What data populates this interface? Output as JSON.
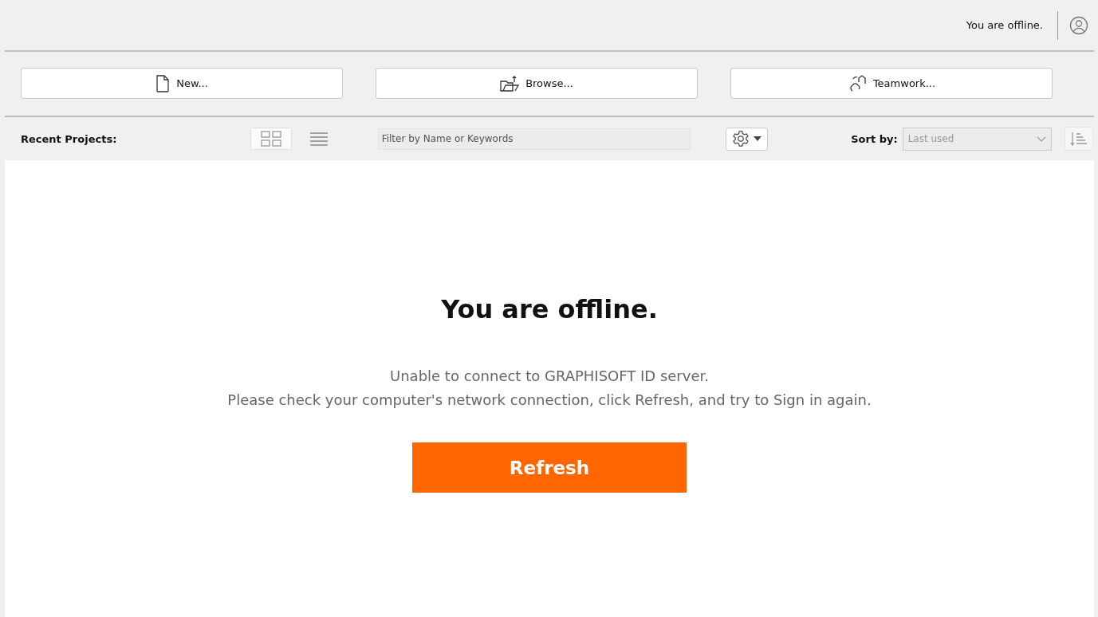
{
  "header": {
    "status": "You are offline."
  },
  "actions": [
    {
      "kind": "new",
      "label": "New..."
    },
    {
      "kind": "browse",
      "label": "Browse..."
    },
    {
      "kind": "teamwork",
      "label": "Teamwork..."
    }
  ],
  "toolbar": {
    "label": "Recent Projects:",
    "views": [
      {
        "kind": "grid",
        "selected": true
      },
      {
        "kind": "list",
        "selected": false
      }
    ],
    "filter": {
      "placeholder": "Filter by Name or Keywords"
    },
    "sort_label": "Sort by:",
    "sort": {
      "value": "Last used",
      "disabled": true
    }
  },
  "message": {
    "title": "You are offline.",
    "lines": [
      "Unable to connect to GRAPHISOFT ID server.",
      "Please check your computer's network connection, click Refresh, and try to Sign in again."
    ],
    "button": "Refresh"
  }
}
